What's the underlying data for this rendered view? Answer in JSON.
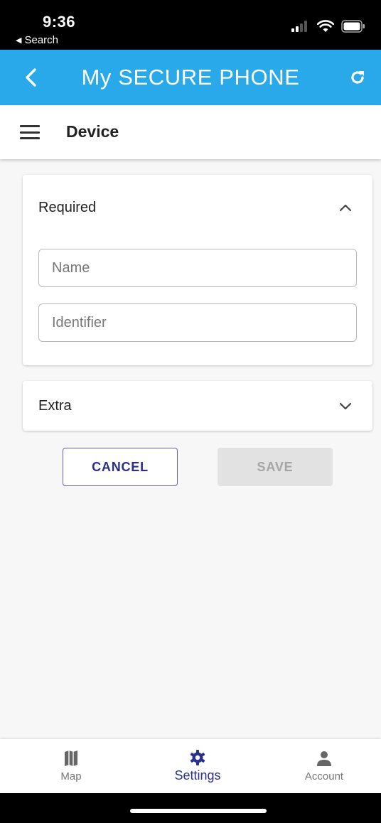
{
  "status_bar": {
    "time": "9:36",
    "back_label": "Search"
  },
  "header": {
    "title": "My SECURE PHONE"
  },
  "sub_header": {
    "title": "Device"
  },
  "sections": {
    "required": {
      "title": "Required",
      "expanded": true,
      "fields": {
        "name": {
          "placeholder": "Name",
          "value": ""
        },
        "identifier": {
          "placeholder": "Identifier",
          "value": ""
        }
      }
    },
    "extra": {
      "title": "Extra",
      "expanded": false
    }
  },
  "actions": {
    "cancel_label": "CANCEL",
    "save_label": "SAVE"
  },
  "bottom_nav": {
    "items": [
      {
        "label": "Map",
        "icon": "map-icon",
        "active": false
      },
      {
        "label": "Settings",
        "icon": "gear-icon",
        "active": true
      },
      {
        "label": "Account",
        "icon": "user-icon",
        "active": false
      }
    ]
  },
  "colors": {
    "header_bg": "#29a9e9",
    "accent": "#2a2f8c",
    "disabled_bg": "#e2e2e2",
    "disabled_text": "#a5a5a5"
  }
}
